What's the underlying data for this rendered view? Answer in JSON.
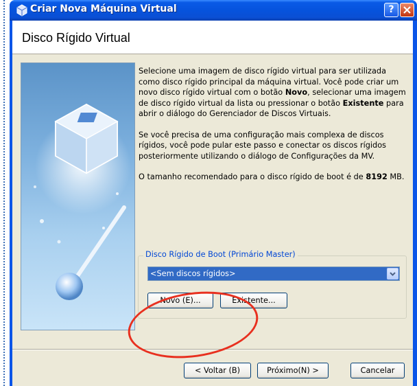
{
  "window": {
    "title": "Criar Nova Máquina Virtual",
    "help_label": "?",
    "close_label": "✕"
  },
  "page": {
    "title": "Disco Rígido Virtual"
  },
  "description": {
    "p1_a": "Selecione uma imagem de disco rígido virtual para ser utilizada como disco rígido principal da máquina virtual. Você pode criar um novo disco rígido virtual com o botão ",
    "p1_b": "Novo",
    "p1_c": ", selecionar uma imagem de disco rígido virtual da lista ou pressionar o botão ",
    "p1_d": "Existente",
    "p1_e": " para abrir o diálogo do Gerenciador de Discos Virtuais.",
    "p2": "Se você precisa de uma configuração mais complexa de discos rígidos, você pode pular este passo e conectar os discos rígidos posteriormente utilizando o diálogo de Configurações da MV.",
    "p3_a": "O tamanho recomendado para o disco rígido de boot é de ",
    "p3_b": "8192",
    "p3_c": " MB."
  },
  "boot_disk": {
    "group_label": "Disco Rígido de Boot (Primário Master)",
    "selected": "<Sem discos rígidos>",
    "new_button": "Novo (E)...",
    "existing_button": "Existente..."
  },
  "footer": {
    "back_button": "< Voltar (B)",
    "next_button": "Próximo(N) >",
    "cancel_button": "Cancelar"
  },
  "colors": {
    "titlebar": "#0a55e8",
    "dialog_bg": "#ece9d8",
    "selection": "#316ac5",
    "annotation": "#e8301f"
  }
}
